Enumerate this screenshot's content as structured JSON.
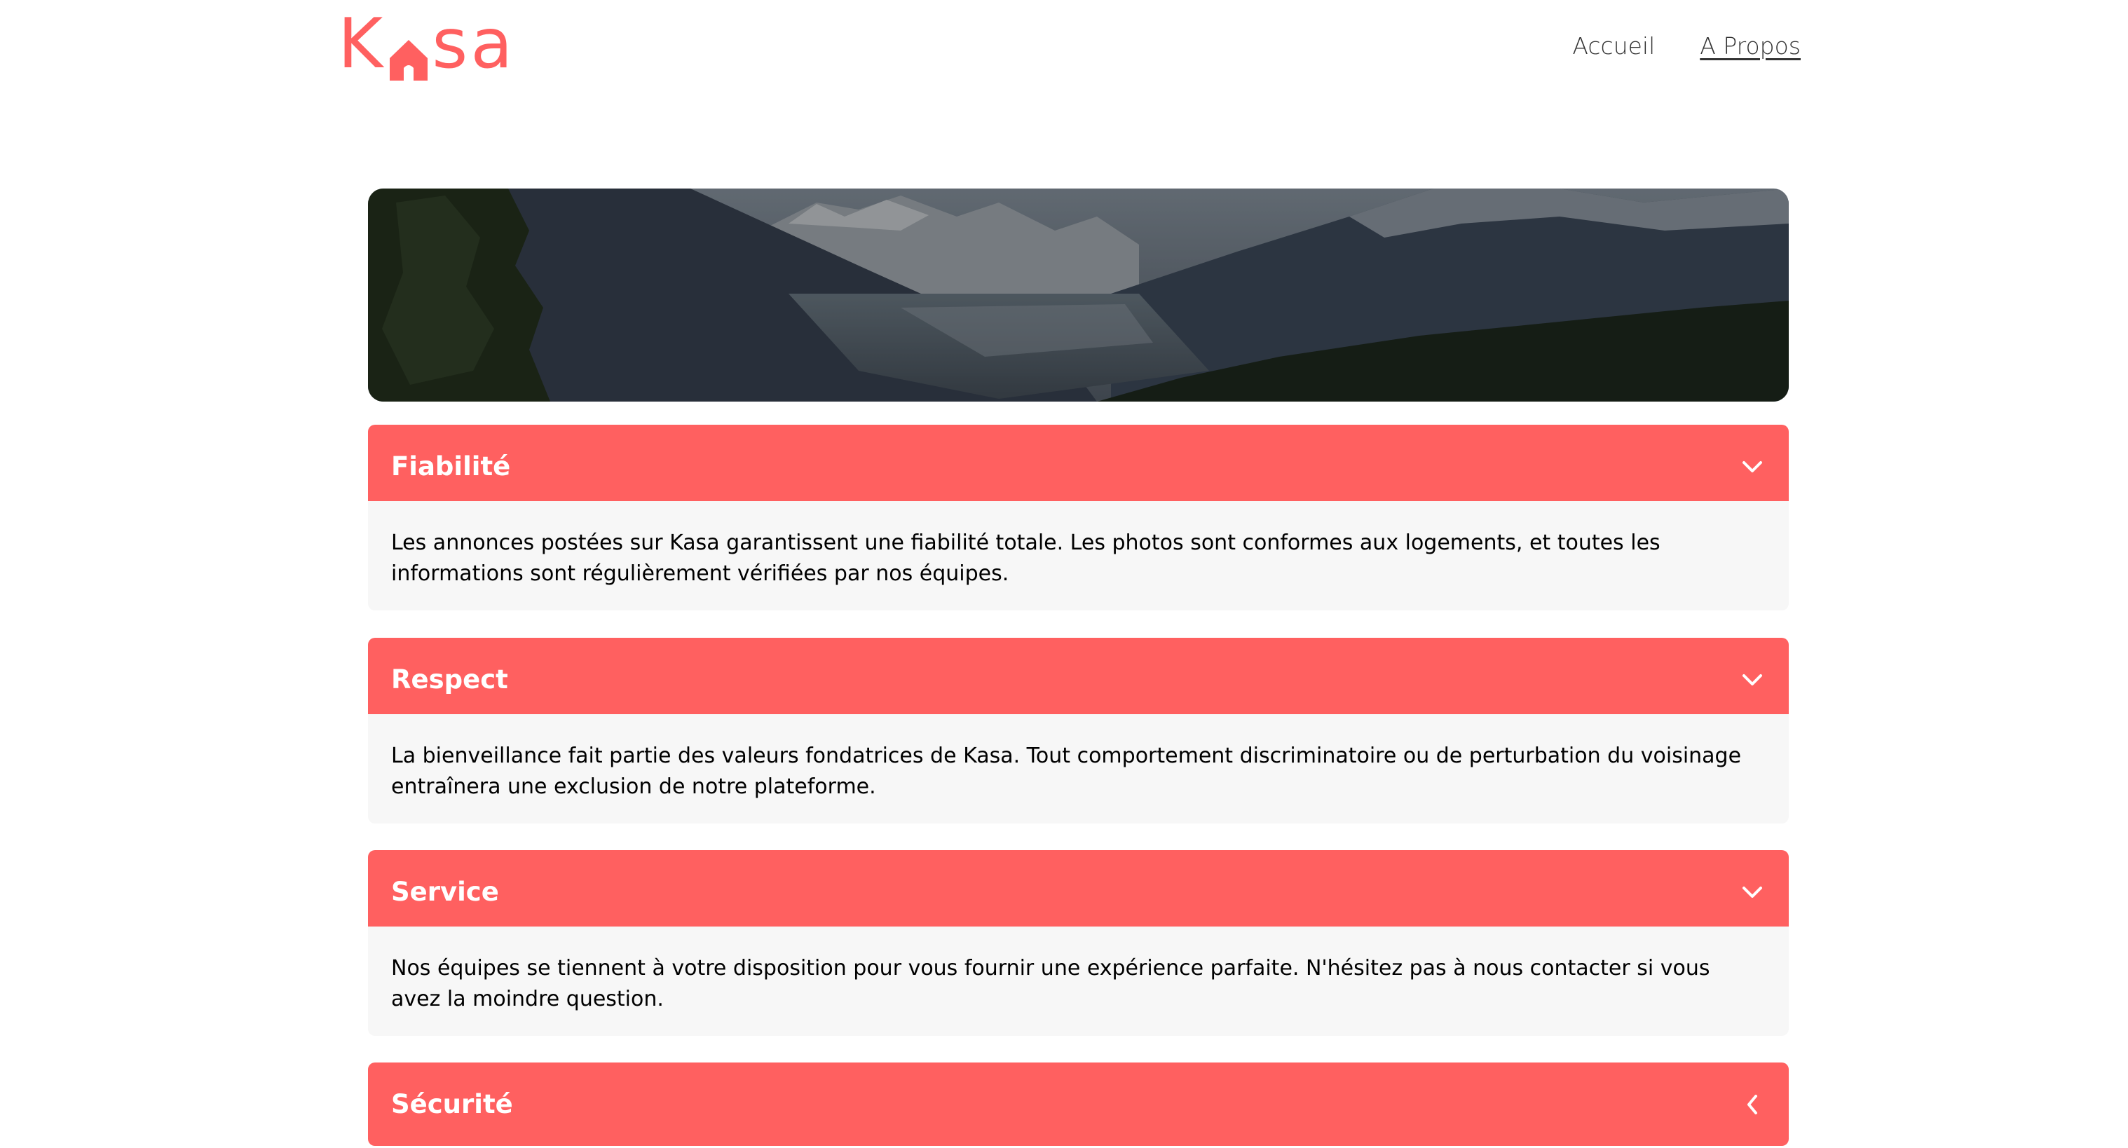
{
  "header": {
    "logo": {
      "left": "K",
      "right": "sa",
      "color": "#FF6060",
      "icon": "house-icon"
    },
    "nav": [
      {
        "label": "Accueil",
        "active": false
      },
      {
        "label": "A Propos",
        "active": true
      }
    ]
  },
  "banner": {
    "alt": "mountain-landscape"
  },
  "collapses": [
    {
      "title": "Fiabilité",
      "open": true,
      "icon": "chevron-down-icon",
      "text": "Les annonces postées sur Kasa garantissent une fiabilité totale. Les photos sont conformes aux logements, et toutes les informations sont régulièrement vérifiées par nos équipes."
    },
    {
      "title": "Respect",
      "open": true,
      "icon": "chevron-down-icon",
      "text": "La bienveillance fait partie des valeurs fondatrices de Kasa. Tout comportement discriminatoire ou de perturbation du voisinage entraînera une exclusion de notre plateforme."
    },
    {
      "title": "Service",
      "open": true,
      "icon": "chevron-down-icon",
      "text": "Nos équipes se tiennent à votre disposition pour vous fournir une expérience parfaite. N'hésitez pas à nous contacter si vous avez la moindre question."
    },
    {
      "title": "Sécurité",
      "open": false,
      "icon": "chevron-left-icon"
    }
  ],
  "colors": {
    "accent": "#FF6060",
    "panel": "#F7F7F7"
  }
}
